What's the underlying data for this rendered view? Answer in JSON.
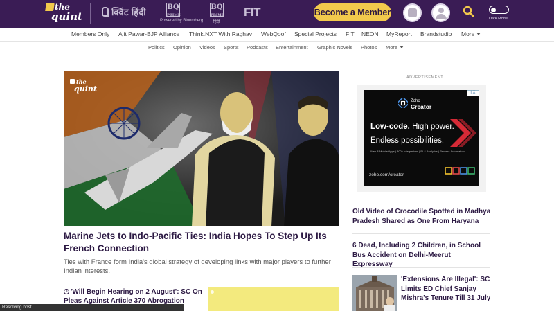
{
  "header": {
    "logo_top": "the",
    "logo_bottom": "quint",
    "hindi_logo": "क्विंट हिंदी",
    "bq_prime": "BQ",
    "bq_prime_sub": "PRIME",
    "bq_powered": "Powered by Bloomberg",
    "bq_hindi": "BQ",
    "bq_hindi_sub": "PRIME",
    "bq_hindi_label": "हिंदी",
    "fit_logo": "FIT",
    "member_button": "Become a Member",
    "dark_mode_label": "Dark Mode"
  },
  "nav_primary": [
    "Members Only",
    "Ajit Pawar-BJP Alliance",
    "Think.NXT With Raghav",
    "WebQoof",
    "Special Projects",
    "FIT",
    "NEON",
    "MyReport",
    "Brandstudio",
    "More"
  ],
  "nav_secondary": [
    "Politics",
    "Opinion",
    "Videos",
    "Sports",
    "Podcasts",
    "Entertainment",
    "Graphic Novels",
    "Photos",
    "More"
  ],
  "hero": {
    "watermark_top": "the",
    "watermark_bottom": "quint",
    "headline": "Marine Jets to Indo-Pacific Ties: India Hopes To Step Up Its French Connection",
    "summary": "Ties with France form India's global strategy of developing links with major players to further Indian interests."
  },
  "sub_story": "'Will Begin Hearing on 2 August': SC On Pleas Against Article 370 Abrogation",
  "status_bar": "Resolving host...",
  "ad": {
    "label": "ADVERTISEMENT",
    "close": "i X",
    "brand_small": "Zoho",
    "brand": "Creator",
    "head_bold": "Low-code.",
    "head_thin": " High power.",
    "head2": "Endless possibilities.",
    "fine_print": "Web & Mobile Apps  |  800+ Integrations  |  BI & Analytics  |  Process Automation",
    "url": "zoho.com/creator"
  },
  "side_stories": [
    "Old Video of Crocodile Spotted in Madhya Pradesh Shared as One From Haryana",
    "6 Dead, Including 2 Children, in School Bus Accident on Delhi-Meerut Expressway",
    "'Extensions Are Illegal': SC Limits ED Chief Sanjay Mishra's Tenure Till 31 July"
  ],
  "colors": {
    "header_bg": "#3a1c55",
    "accent_yellow": "#f2c94c",
    "headline": "#2d1a44"
  }
}
